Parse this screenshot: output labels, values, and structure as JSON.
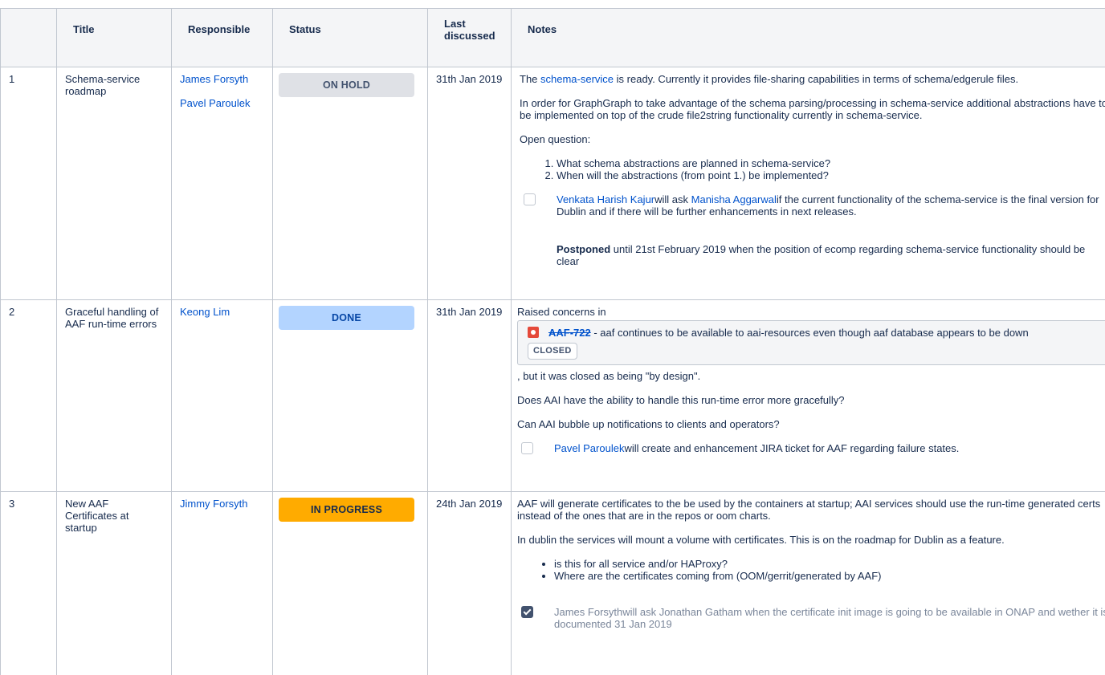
{
  "headers": {
    "num": "",
    "title": "Title",
    "responsible": "Responsible",
    "status": "Status",
    "last_line1": "Last",
    "last_line2": "discussed",
    "notes": "Notes"
  },
  "colors": {
    "link": "#0052cc",
    "on_hold": "#dfe1e6",
    "done": "#b3d4ff",
    "in_progress": "#ffab00"
  },
  "rows": [
    {
      "num": "1",
      "title": "Schema-service roadmap",
      "responsible": [
        "James Forsyth",
        "Pavel Paroulek"
      ],
      "status": "ON HOLD",
      "last": "31th Jan 2019",
      "notes": {
        "p1_prefix": "The ",
        "p1_link": "schema-service",
        "p1_suffix": " is ready. Currently it provides file-sharing capabilities in terms of schema/edgerule files.",
        "p2": "In order for GraphGraph to take advantage of the schema parsing/processing in schema-service additional abstractions have to be implemented on top of the crude file2string functionality currently in schema-service.",
        "p3": "Open question:",
        "questions": [
          "What schema abstractions are planned in schema-service?",
          "When will the abstractions (from point 1.) be implemented?"
        ],
        "task_user1": "Venkata Harish Kajur",
        "task_mid": "will ask ",
        "task_user2": "Manisha Aggarwal",
        "task_rest": "if the current functionality of the schema-service is the final version for Dublin and if there will be further enhancements in next releases.",
        "postponed_bold": "Postponed",
        "postponed_rest": " until 21st February 2019 when the position of ecomp regarding schema-service functionality should be clear"
      }
    },
    {
      "num": "2",
      "title": "Graceful handling of AAF run-time errors",
      "responsible": [
        "Keong Lim"
      ],
      "status": "DONE",
      "last": "31th Jan 2019",
      "notes": {
        "p1": "Raised concerns in",
        "jira_key": "AAF-722",
        "jira_summary": " - aaf continues to be available to aai-resources even though aaf database appears to be down",
        "jira_status": "CLOSED",
        "p2": ", but it was closed as being \"by design\".",
        "p3": "Does AAI have the ability to handle this run-time error more gracefully?",
        "p4": "Can AAI bubble up notifications to clients and operators?",
        "task_user": "Pavel Paroulek",
        "task_rest": "will create and enhancement JIRA ticket for AAF regarding failure states."
      }
    },
    {
      "num": "3",
      "title": "New AAF Certificates at startup",
      "responsible": [
        "Jimmy Forsyth"
      ],
      "status": "IN PROGRESS",
      "last": "24th Jan 2019",
      "notes": {
        "p1": "AAF will generate certificates to the be used by the containers at startup; AAI services should use the run-time generated certs instead of the ones that are in the repos or oom charts.",
        "p2": "In dublin the services will mount a volume with certificates. This is on the roadmap for Dublin as a feature.",
        "bullets": [
          "is this for all service and/or HAProxy?",
          "Where are the certificates coming from (OOM/gerrit/generated by AAF)"
        ],
        "task_text": "James Forsythwill ask Jonathan Gatham when the certificate init image is going to be available in ONAP and wether it is documented 31 Jan 2019"
      }
    }
  ]
}
